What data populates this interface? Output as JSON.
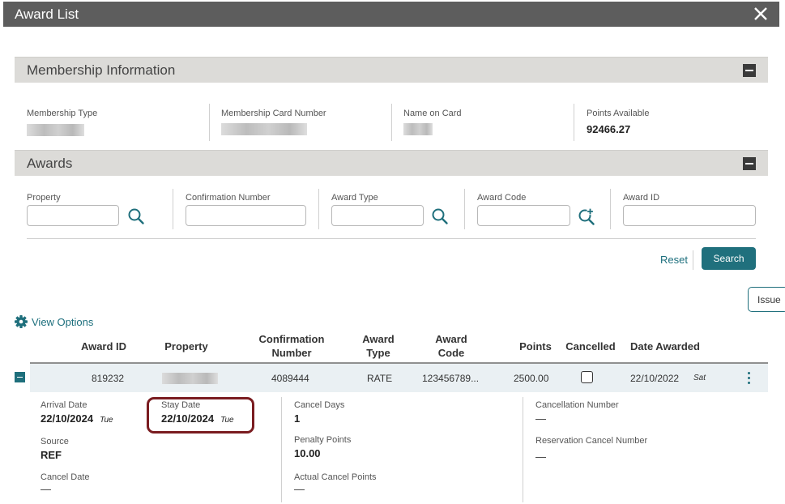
{
  "window": {
    "title": "Award List",
    "close_icon": "close-icon"
  },
  "membership": {
    "section_title": "Membership Information",
    "fields": [
      {
        "label": "Membership Type",
        "value": ""
      },
      {
        "label": "Membership Card Number",
        "value": ""
      },
      {
        "label": "Name on Card",
        "value": ""
      },
      {
        "label": "Points Available",
        "value": "92466.27"
      }
    ]
  },
  "awards": {
    "section_title": "Awards",
    "filters": {
      "property": {
        "label": "Property",
        "value": ""
      },
      "confirmation_number": {
        "label": "Confirmation Number",
        "value": ""
      },
      "award_type": {
        "label": "Award Type",
        "value": ""
      },
      "award_code": {
        "label": "Award Code",
        "value": ""
      },
      "award_id": {
        "label": "Award ID",
        "value": ""
      }
    },
    "reset_label": "Reset",
    "search_label": "Search"
  },
  "issue_label": "Issue",
  "view_options_label": "View Options",
  "table": {
    "columns": [
      "Award ID",
      "Property",
      "Confirmation Number",
      "Award Type",
      "Award Code",
      "Points",
      "Cancelled",
      "Date Awarded"
    ],
    "row": {
      "award_id": "819232",
      "property": "",
      "confirmation_number": "4089444",
      "award_type": "RATE",
      "award_code": "123456789...",
      "points": "2500.00",
      "cancelled": false,
      "date_awarded": "22/10/2022",
      "date_awarded_dow": "Sat"
    }
  },
  "details": {
    "arrival_date": {
      "label": "Arrival Date",
      "value": "22/10/2024",
      "dow": "Tue"
    },
    "stay_date": {
      "label": "Stay Date",
      "value": "22/10/2024",
      "dow": "Tue"
    },
    "source": {
      "label": "Source",
      "value": "REF"
    },
    "cancel_date": {
      "label": "Cancel Date",
      "value": "—"
    },
    "cancel_days": {
      "label": "Cancel Days",
      "value": "1"
    },
    "penalty_points": {
      "label": "Penalty Points",
      "value": "10.00"
    },
    "actual_cancel_points": {
      "label": "Actual Cancel Points",
      "value": "—"
    },
    "cancellation_number": {
      "label": "Cancellation Number",
      "value": "—"
    },
    "reservation_cancel_number": {
      "label": "Reservation Cancel Number",
      "value": "—"
    }
  },
  "colors": {
    "accent": "#1f6f7c",
    "titlebar": "#5d5d5d",
    "highlight_outline": "#7a1c20"
  }
}
